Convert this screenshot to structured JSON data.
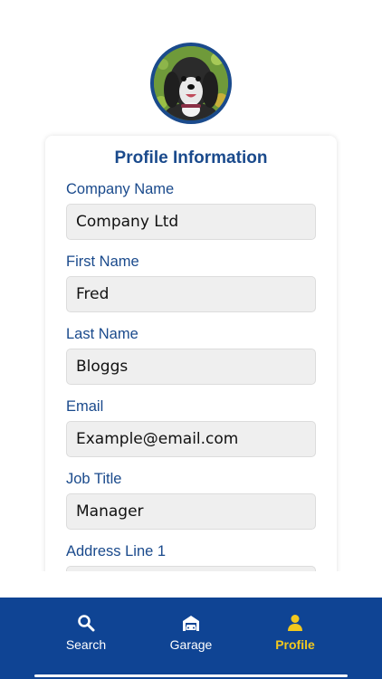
{
  "profile": {
    "title": "Profile Information",
    "fields": [
      {
        "label": "Company Name",
        "value": "Company Ltd"
      },
      {
        "label": "First Name",
        "value": "Fred"
      },
      {
        "label": "Last Name",
        "value": "Bloggs"
      },
      {
        "label": "Email",
        "value": "Example@email.com"
      },
      {
        "label": "Job Title",
        "value": "Manager"
      },
      {
        "label": "Address Line 1",
        "value": ""
      }
    ]
  },
  "nav": {
    "items": [
      {
        "label": "Search",
        "icon": "search-icon",
        "active": false
      },
      {
        "label": "Garage",
        "icon": "car-icon",
        "active": false
      },
      {
        "label": "Profile",
        "icon": "person-icon",
        "active": true
      }
    ]
  },
  "colors": {
    "primary": "#1a4a8c",
    "nav_background": "#0f4494",
    "active_tab": "#f2c81e",
    "input_background": "#efefef"
  }
}
